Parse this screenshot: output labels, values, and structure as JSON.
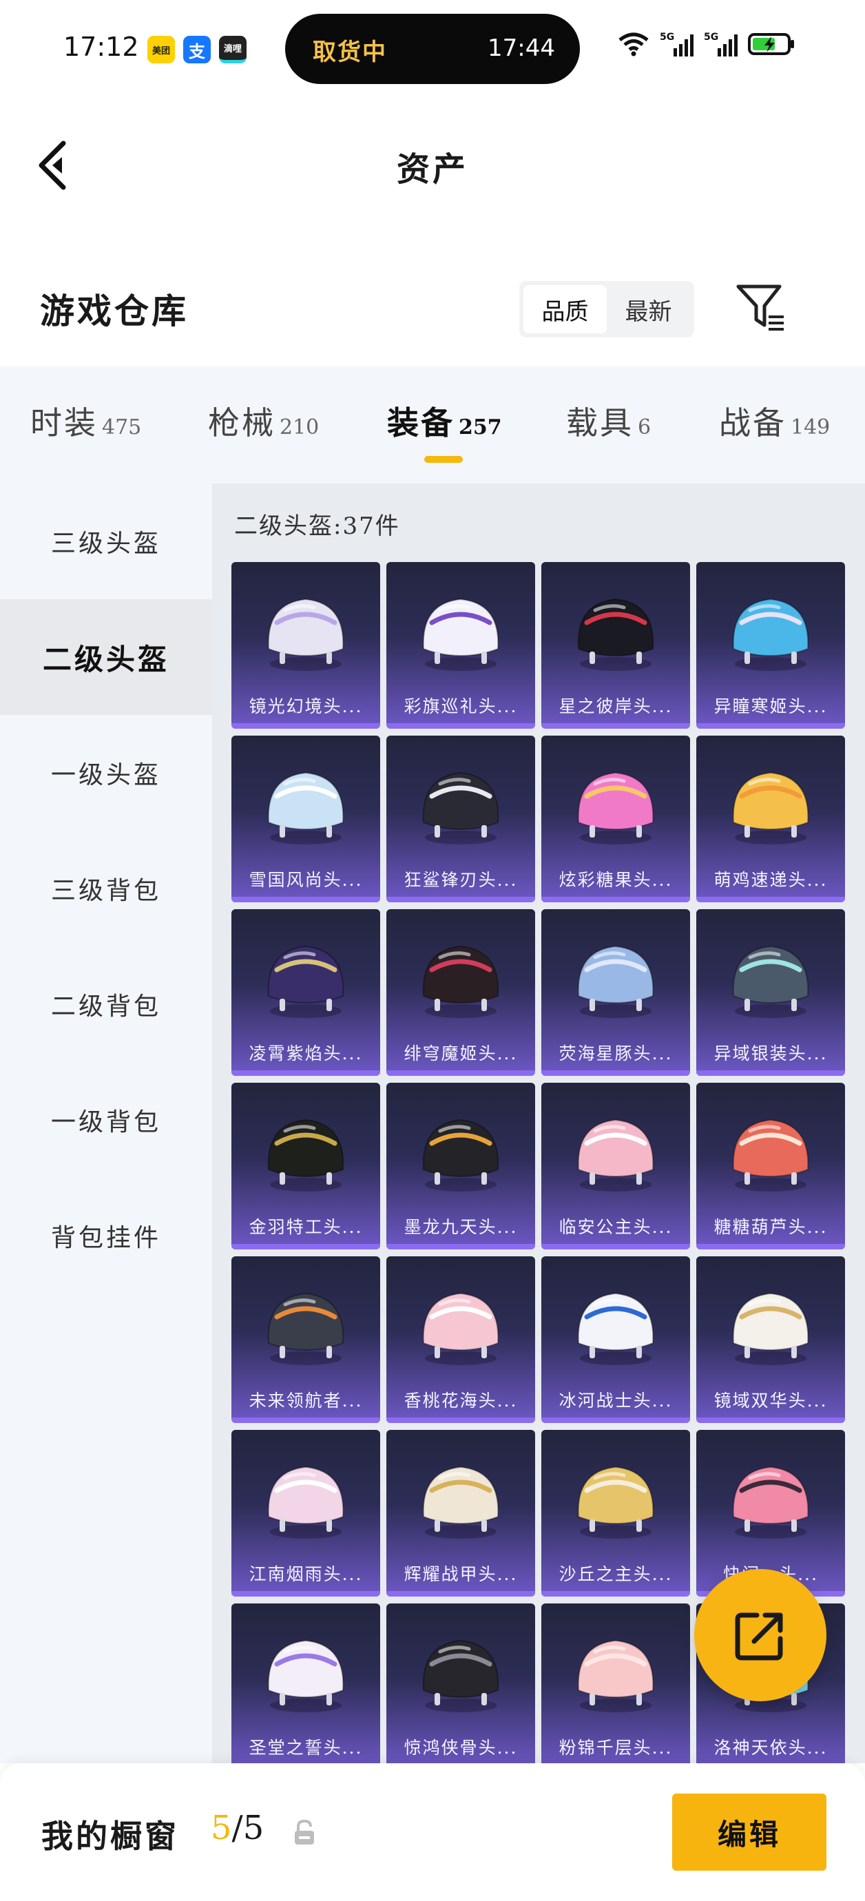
{
  "status_bar": {
    "time": "17:12",
    "badges": [
      {
        "label": "美团",
        "color": "#ffd100"
      },
      {
        "label": "支",
        "color": "#1677ff"
      },
      {
        "label": "滴哩",
        "color": "#222222"
      }
    ],
    "pill_status": "取货中",
    "pill_time": "17:44",
    "network": "5G",
    "icons": [
      "wifi-icon",
      "signal-5g-icon",
      "signal-5g-icon",
      "battery-charging-icon"
    ]
  },
  "header": {
    "title": "资产",
    "back_icon": "chevron-left-icon"
  },
  "warehouse": {
    "title": "游戏仓库",
    "sort_options": [
      "品质",
      "最新"
    ],
    "active_sort": "品质",
    "filter_icon": "filter-icon"
  },
  "categories": [
    {
      "name": "时装",
      "count": "475"
    },
    {
      "name": "枪械",
      "count": "210"
    },
    {
      "name": "装备",
      "count": "257"
    },
    {
      "name": "载具",
      "count": "6"
    },
    {
      "name": "战备",
      "count": "149"
    }
  ],
  "active_category": "装备",
  "sidebar": {
    "items": [
      "三级头盔",
      "二级头盔",
      "一级头盔",
      "三级背包",
      "二级背包",
      "一级背包",
      "背包挂件"
    ],
    "active": "二级头盔"
  },
  "content": {
    "count_label": "二级头盔:37件"
  },
  "items": [
    {
      "name": "镜光幻境头...",
      "color": "#e6e3f2",
      "accent": "#b9a6e6"
    },
    {
      "name": "彩旗巡礼头...",
      "color": "#f2f0fa",
      "accent": "#7a4fc6"
    },
    {
      "name": "星之彼岸头...",
      "color": "#1a1a22",
      "accent": "#d6364a"
    },
    {
      "name": "异瞳寒姬头...",
      "color": "#4bb7e8",
      "accent": "#e8e2f6"
    },
    {
      "name": "雪国风尚头...",
      "color": "#c9e2f5",
      "accent": "#ffffff"
    },
    {
      "name": "狂鲨锋刃头...",
      "color": "#2a2a34",
      "accent": "#e8e8f0"
    },
    {
      "name": "炫彩糖果头...",
      "color": "#f07ac8",
      "accent": "#f6c86a"
    },
    {
      "name": "萌鸡速递头...",
      "color": "#f4c04a",
      "accent": "#f39a3a"
    },
    {
      "name": "凌霄紫焰头...",
      "color": "#3a2e6a",
      "accent": "#d8c27a"
    },
    {
      "name": "绯穹魔姬头...",
      "color": "#2a2024",
      "accent": "#d23c5a"
    },
    {
      "name": "荧海星豚头...",
      "color": "#9ab8e6",
      "accent": "#dfe8fa"
    },
    {
      "name": "异域银装头...",
      "color": "#4a5a6a",
      "accent": "#9fe3e6"
    },
    {
      "name": "金羽特工头...",
      "color": "#1e201c",
      "accent": "#c9a84a"
    },
    {
      "name": "墨龙九天头...",
      "color": "#242428",
      "accent": "#e8a23a"
    },
    {
      "name": "临安公主头...",
      "color": "#f4b8c8",
      "accent": "#ffffff"
    },
    {
      "name": "糖糖葫芦头...",
      "color": "#e86a5a",
      "accent": "#f8e6d6"
    },
    {
      "name": "未来领航者...",
      "color": "#3a3e4a",
      "accent": "#e88a3a"
    },
    {
      "name": "香桃花海头...",
      "color": "#f6c6d2",
      "accent": "#ffffff"
    },
    {
      "name": "冰河战士头...",
      "color": "#f2f4fa",
      "accent": "#2e6ad6"
    },
    {
      "name": "镜域双华头...",
      "color": "#f4f0ea",
      "accent": "#d8b46a"
    },
    {
      "name": "江南烟雨头...",
      "color": "#f2d6e8",
      "accent": "#ffffff"
    },
    {
      "name": "辉耀战甲头...",
      "color": "#efe6d6",
      "accent": "#d8b25a"
    },
    {
      "name": "沙丘之主头...",
      "color": "#e6c46a",
      "accent": "#f6eedc"
    },
    {
      "name": "快闪…头...",
      "color": "#f08aa6",
      "accent": "#3a2a3a"
    },
    {
      "name": "圣堂之誓头...",
      "color": "#f4eef8",
      "accent": "#9a7ae6"
    },
    {
      "name": "惊鸿侠骨头...",
      "color": "#26262c",
      "accent": "#8a8a96"
    },
    {
      "name": "粉锦千层头...",
      "color": "#f8c8c8",
      "accent": "#ffe6e6"
    },
    {
      "name": "洛神天依头...",
      "color": "#7ad2e6",
      "accent": "#b48af0"
    }
  ],
  "fab": {
    "icon": "share-external-icon"
  },
  "bottom_bar": {
    "label": "我的橱窗",
    "current": "5",
    "separator": "/",
    "total": "5",
    "lock_icon": "lock-icon",
    "edit_label": "编辑"
  }
}
